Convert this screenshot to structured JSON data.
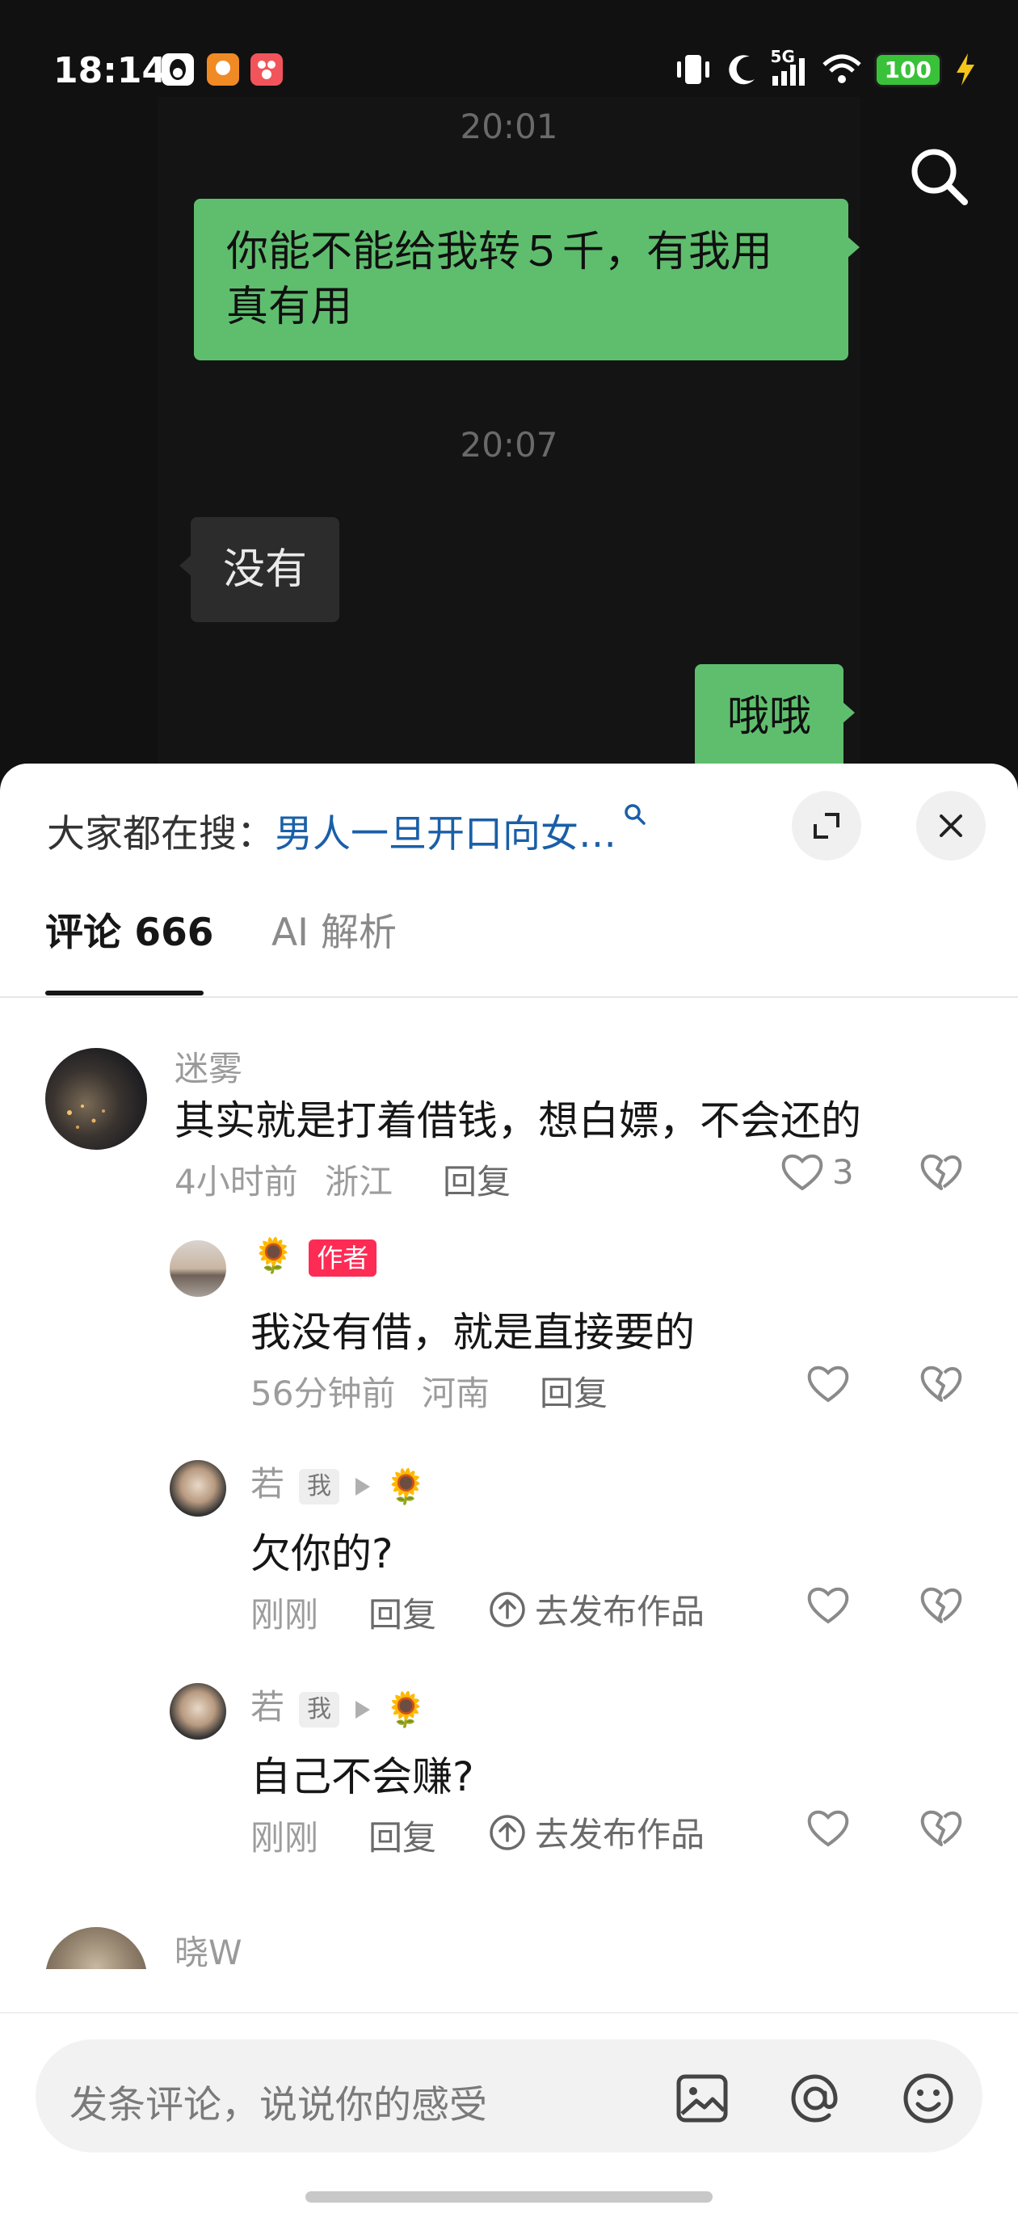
{
  "status_bar": {
    "time": "18:14",
    "network": "5G",
    "battery": "100",
    "apps": [
      "qq-icon",
      "app-icon-orange",
      "app-icon-red"
    ],
    "icons": [
      "vibrate-icon",
      "moon-icon",
      "signal-icon",
      "wifi-icon",
      "charging-icon"
    ]
  },
  "chat": {
    "timestamp_1": "20:01",
    "msg_1_line1": "你能不能给我转５千，有我用",
    "msg_1_line2": "真有用",
    "timestamp_2": "20:07",
    "msg_2": "没有",
    "msg_3": "哦哦"
  },
  "sheet": {
    "trending_prefix": "大家都在搜：",
    "trending_query": "男人一旦开口向女…",
    "tabs": [
      {
        "label": "评论 666",
        "active": true
      },
      {
        "label": "AI 解析",
        "active": false
      }
    ]
  },
  "comments": [
    {
      "name": "迷雾",
      "text": "其实就是打着借钱，想白嫖，不会还的",
      "time": "4小时前",
      "location": "浙江",
      "reply": "回复",
      "likes": "3"
    },
    {
      "name": "🌻",
      "badge": "作者",
      "text": "我没有借，就是直接要的",
      "time": "56分钟前",
      "location": "河南",
      "reply": "回复"
    },
    {
      "name": "若",
      "badge": "我",
      "reply_to": "🌻",
      "text": "欠你的?",
      "time": "刚刚",
      "reply": "回复",
      "publish": "去发布作品"
    },
    {
      "name": "若",
      "badge": "我",
      "reply_to": "🌻",
      "text": "自己不会赚?",
      "time": "刚刚",
      "reply": "回复",
      "publish": "去发布作品"
    },
    {
      "name": "晓W"
    }
  ],
  "input": {
    "placeholder": "发条评论，说说你的感受"
  },
  "colors": {
    "bubble_green": "#5fbe6e",
    "link_blue": "#1a5fa8",
    "author_red": "#fe2c55"
  }
}
